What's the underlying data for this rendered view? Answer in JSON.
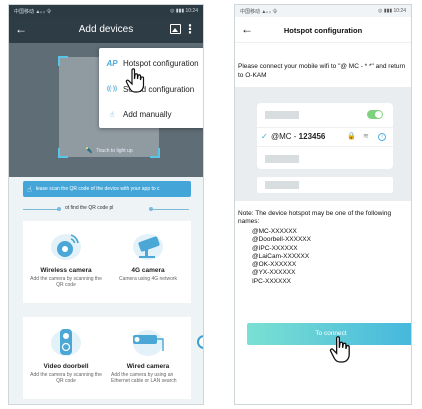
{
  "left_screen": {
    "status_left": "中国移动 ▲ᵢₗ ᵢₗ 令",
    "status_right": "◎ ▮▮▮ 10:24",
    "title": "Add devices",
    "back_glyph": "←",
    "more_glyph": "⋮",
    "scanner": {
      "torch_label": "Touch to light up",
      "torch_glyph": "🔦"
    },
    "menu": {
      "items": [
        {
          "icon": "AP",
          "label": "Hotspot configuration"
        },
        {
          "icon": "((·))",
          "label": "Sound configuration"
        },
        {
          "icon": "☝",
          "label": "Add manually"
        }
      ]
    },
    "hint_text": "lease scan the QR code of the device with your app to c",
    "divider_text": "ot find the QR code pl",
    "cards": [
      {
        "name": "Wireless camera",
        "desc": "Add the camera by scanning the QR code"
      },
      {
        "name": "4G camera",
        "desc": "Camera using 4G network"
      },
      {
        "name": "Video doorbell",
        "desc": "Add the camera by scanning the QR code"
      },
      {
        "name": "Wired camera",
        "desc": "Add the camera by using an Ethernet cable or LAN search"
      }
    ]
  },
  "right_screen": {
    "status_left": "中国移动 ▲ᵢₗ ᵢₗ 令",
    "status_right": "◎ ▮▮▮ 10:24",
    "back_glyph": "←",
    "title": "Hotspot configuration",
    "instruction": "Please connect your mobile wifi to \"@ MC - * *\" and return to O-KAM",
    "wifi": {
      "ssid_prefix": "@MC - ",
      "ssid_number": "123456",
      "check_glyph": "✓",
      "lock_glyph": "🔒",
      "wifi_glyph": "≋",
      "info_glyph": "i"
    },
    "note": "Note: The device hotspot may be one of the following names:",
    "names": [
      "@MC-XXXXXX",
      "@Doorbell-XXXXXX",
      "@IPC-XXXXXX",
      "@LaiCam-XXXXXX",
      "@OK-XXXXXX",
      "@YX-XXXXXX",
      "IPC-XXXXXX"
    ],
    "connect_label": "To connect"
  },
  "colors": {
    "accent": "#44a6d8",
    "dark_bar": "#2e3c46",
    "toggle_on": "#7fd27d"
  }
}
